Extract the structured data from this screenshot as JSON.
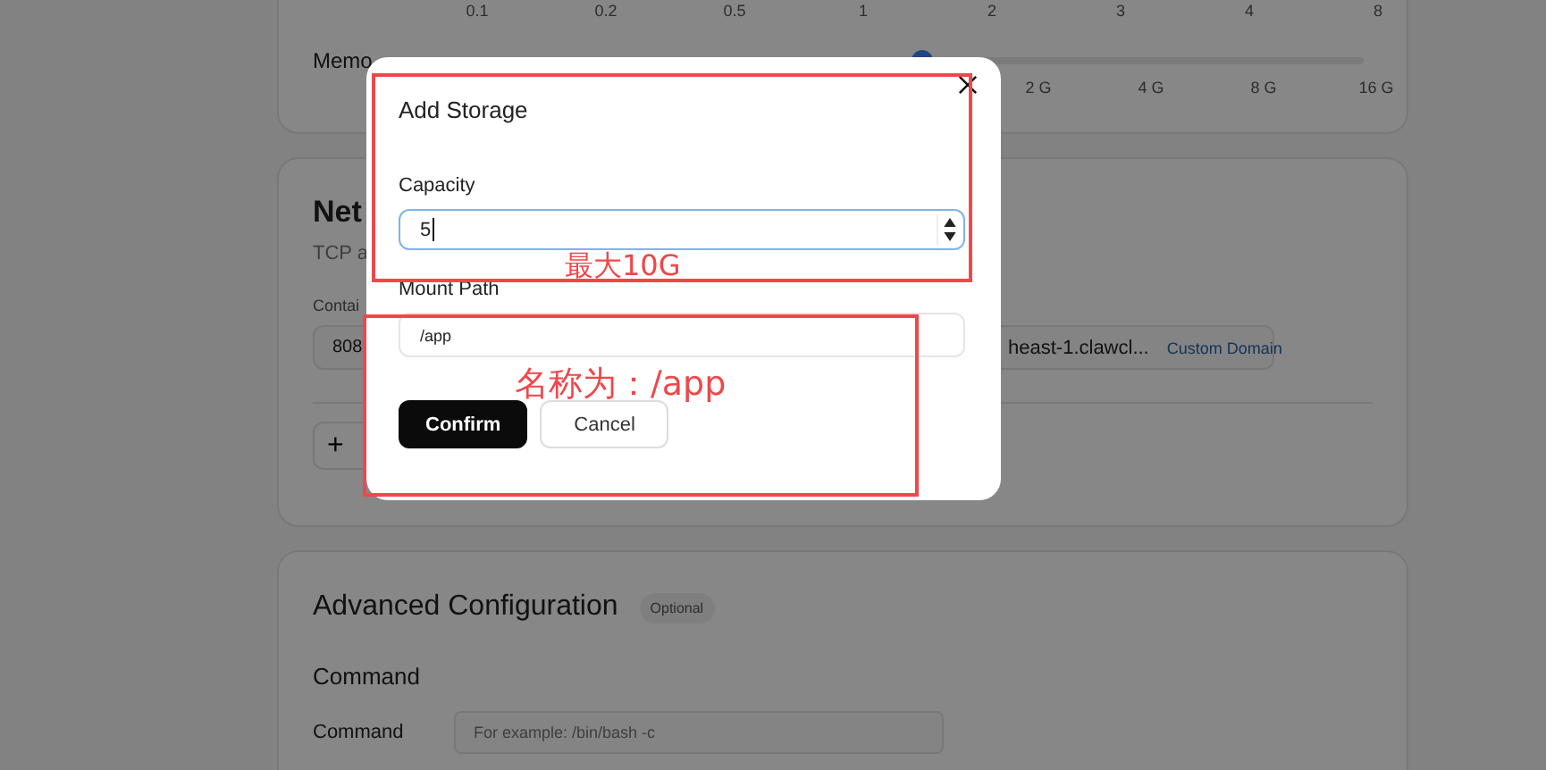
{
  "background": {
    "cpu_ticks": [
      "0.1",
      "0.2",
      "0.5",
      "1",
      "2",
      "3",
      "4",
      "8"
    ],
    "memory": {
      "label": "Memo",
      "level": 0.53,
      "ticks": [
        "2 G",
        "4 G",
        "8 G",
        "16 G"
      ]
    },
    "network": {
      "title": "Net",
      "subtitle": "TCP a",
      "container_label": "Contai",
      "port_value": "808",
      "domain_value": "heast-1.clawcl...",
      "domain_link": "Custom Domain",
      "add_button": "+"
    },
    "advanced": {
      "title": "Advanced Configuration",
      "badge": "Optional",
      "section": "Command",
      "command_label": "Command",
      "command_placeholder": "For example: /bin/bash -c"
    }
  },
  "dialog": {
    "title": "Add Storage",
    "capacity_label": "Capacity",
    "capacity_value": "5",
    "mount_label": "Mount Path",
    "mount_value": "/app",
    "buttons": [
      {
        "label": "Confirm",
        "kind": "primary"
      },
      {
        "label": "Cancel",
        "kind": "secondary"
      }
    ]
  },
  "annotations": [
    {
      "text": "最大10G"
    },
    {
      "text": "名称为：/app"
    }
  ]
}
